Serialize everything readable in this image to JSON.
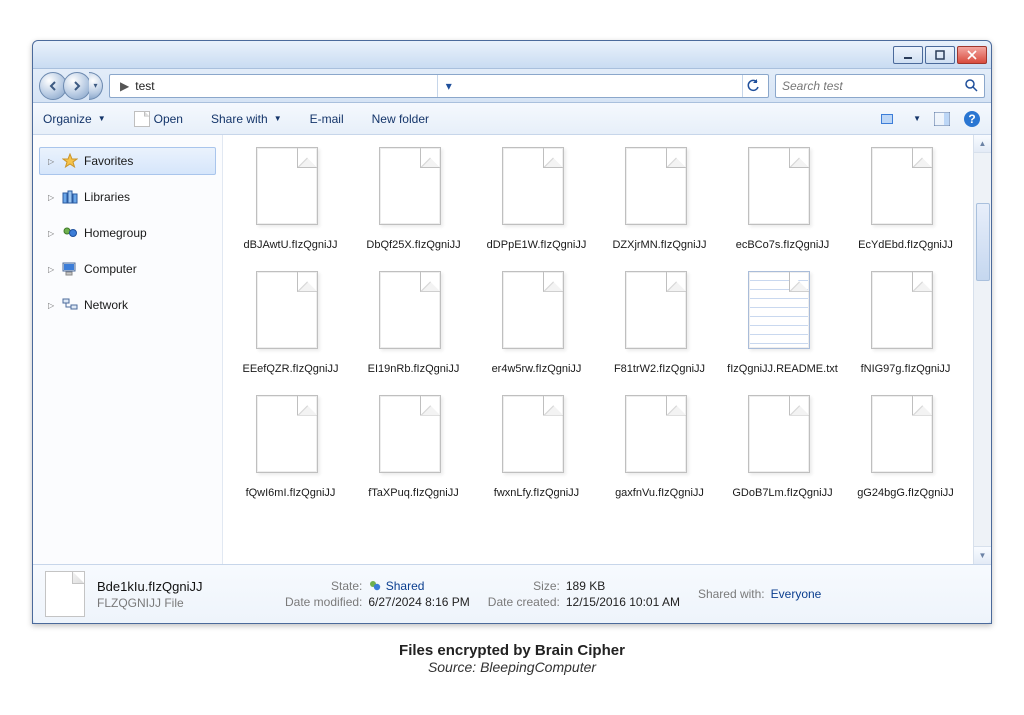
{
  "breadcrumb": {
    "chev": "▶",
    "folder": "test"
  },
  "search": {
    "placeholder": "Search test"
  },
  "toolbar": {
    "organize": "Organize",
    "open": "Open",
    "share": "Share with",
    "email": "E-mail",
    "newfolder": "New folder"
  },
  "sidebar": {
    "favorites": "Favorites",
    "libraries": "Libraries",
    "homegroup": "Homegroup",
    "computer": "Computer",
    "network": "Network"
  },
  "files": [
    {
      "name": "dBJAwtU.fIzQgniJJ"
    },
    {
      "name": "DbQf25X.fIzQgniJJ"
    },
    {
      "name": "dDPpE1W.fIzQgniJJ"
    },
    {
      "name": "DZXjrMN.fIzQgniJJ"
    },
    {
      "name": "ecBCo7s.fIzQgniJJ"
    },
    {
      "name": "EcYdEbd.fIzQgniJJ"
    },
    {
      "name": "EEefQZR.fIzQgniJJ"
    },
    {
      "name": "EI19nRb.fIzQgniJJ"
    },
    {
      "name": "er4w5rw.fIzQgniJJ"
    },
    {
      "name": "F81trW2.fIzQgniJJ"
    },
    {
      "name": "fIzQgniJJ.README.txt",
      "readme": true
    },
    {
      "name": "fNIG97g.fIzQgniJJ"
    },
    {
      "name": "fQwI6mI.fIzQgniJJ"
    },
    {
      "name": "fTaXPuq.fIzQgniJJ"
    },
    {
      "name": "fwxnLfy.fIzQgniJJ"
    },
    {
      "name": "gaxfnVu.fIzQgniJJ"
    },
    {
      "name": "GDoB7Lm.fIzQgniJJ"
    },
    {
      "name": "gG24bgG.fIzQgniJJ"
    }
  ],
  "details": {
    "name": "Bde1kIu.fIzQgniJJ",
    "type": "FLZQGNIJJ File",
    "state_label": "State:",
    "state_value": "Shared",
    "modified_label": "Date modified:",
    "modified_value": "6/27/2024 8:16 PM",
    "size_label": "Size:",
    "size_value": "189 KB",
    "created_label": "Date created:",
    "created_value": "12/15/2016 10:01 AM",
    "sharedwith_label": "Shared with:",
    "sharedwith_value": "Everyone"
  },
  "caption": {
    "title": "Files encrypted by Brain Cipher",
    "source": "Source: BleepingComputer"
  }
}
